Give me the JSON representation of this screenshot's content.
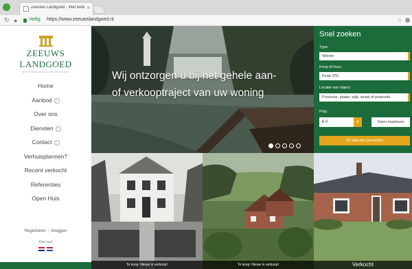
{
  "browser": {
    "tab_title": "Zeeuws Landgoed - Wat betekent...",
    "secure_label": "Veilig",
    "url": "https://www.zeeuwslandgoed.nl"
  },
  "sidebar": {
    "logo_name": "ZEEUWS LANDGOED",
    "logo_sub": "BUITENGEWOON WONEN",
    "menu": [
      {
        "label": "Home",
        "has_chevron": false
      },
      {
        "label": "Aanbod",
        "has_chevron": true
      },
      {
        "label": "Over ons",
        "has_chevron": false
      },
      {
        "label": "Diensten",
        "has_chevron": true
      },
      {
        "label": "Contact",
        "has_chevron": true
      },
      {
        "label": "Verhuisplannen?",
        "has_chevron": false
      },
      {
        "label": "Recent verkocht",
        "has_chevron": false
      },
      {
        "label": "Referenties",
        "has_chevron": false
      },
      {
        "label": "Open Huis",
        "has_chevron": false
      }
    ],
    "register": "Registreren",
    "login": "Inloggen",
    "language_label": "Kies taal",
    "languages": [
      "en-flag-icon",
      "nl-flag-icon"
    ]
  },
  "hero": {
    "line1": "Wij ontzorgen u bij het gehele aan-",
    "line2": "of verkooptraject van uw woning",
    "slide_count": 5,
    "active_slide": 1
  },
  "search": {
    "title": "Snel zoeken",
    "type_label": "Type:",
    "type_value": "Wonen",
    "mode_label": "Koop of huur:",
    "mode_value": "Koop (25)",
    "location_label": "Locatie van object:",
    "location_placeholder": "Provincie, plaats, wijk, straat of postcode",
    "price_label": "Prijs:",
    "price_min": "€ 0",
    "price_max": "Geen maximum",
    "results_button": "25 objecten gevonden"
  },
  "tiles": [
    {
      "caption": "Te koop: Nieuw in verkoop!"
    },
    {
      "caption": "Te koop: Nieuw in verkoop!"
    },
    {
      "caption": "Verkocht"
    }
  ],
  "colors": {
    "brand_green": "#1c6b3b",
    "accent_orange": "#e3a51c",
    "logo_gold": "#c9a227"
  }
}
